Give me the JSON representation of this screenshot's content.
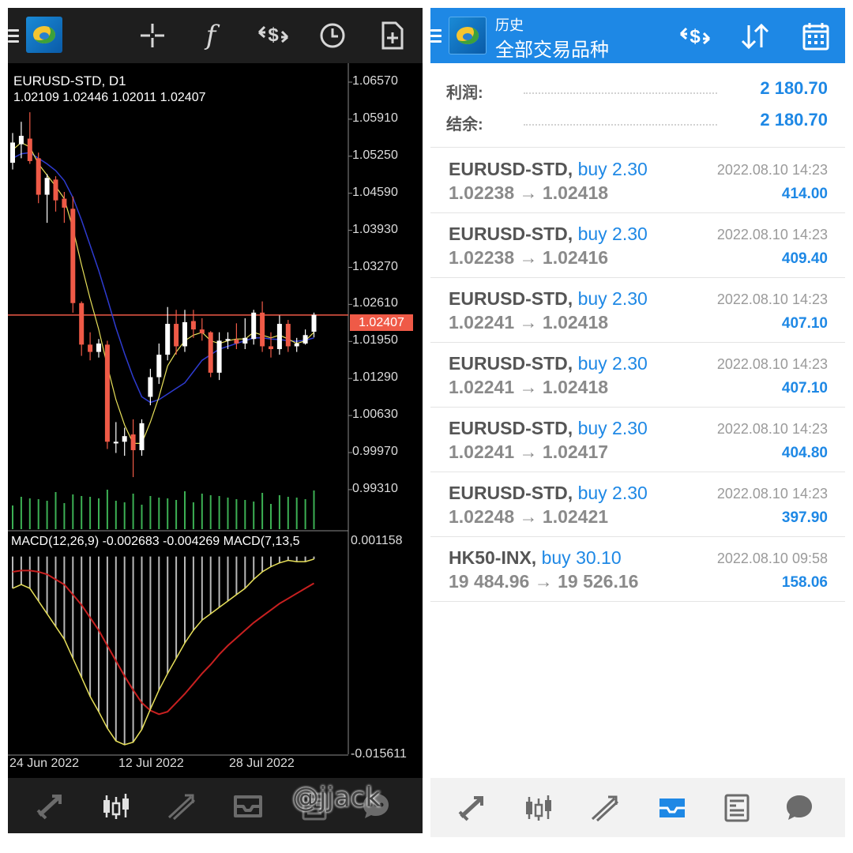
{
  "left": {
    "symbol": "EURUSD-STD, D1",
    "ohlc": "1.02109 1.02446 1.02011 1.02407",
    "price_scale": [
      "1.06570",
      "1.05910",
      "1.05250",
      "1.04590",
      "1.03930",
      "1.03270",
      "1.02610",
      "1.01950",
      "1.01290",
      "1.00630",
      "0.99970",
      "0.99310"
    ],
    "current_price": "1.02407",
    "macd_label": "MACD(12,26,9) -0.002683 -0.004269 MACD(7,13,5",
    "macd_scale_top": "0.001158",
    "macd_scale_bottom": "-0.015611",
    "dates": [
      "24 Jun 2022",
      "12 Jul 2022",
      "28 Jul 2022"
    ],
    "toolbar_icons": [
      "menu-icon",
      "app-logo",
      "crosshair-icon",
      "indicators-icon",
      "dollar-swap-icon",
      "timeframe-clock-icon",
      "new-order-icon"
    ],
    "nav_icons": [
      "quotes-icon",
      "chart-icon",
      "trade-icon",
      "history-icon",
      "news-icon",
      "chat-icon"
    ],
    "colors": {
      "bull": "#ffffff",
      "bear": "#ef5a47",
      "ma_fast": "#e8e05a",
      "ma_slow": "#2e3bd0",
      "macd_main": "#e8e05a",
      "macd_signal": "#c82020",
      "hist": "#b8b8b8",
      "volume": "#3cb054"
    }
  },
  "chart_data": {
    "type": "candlestick",
    "symbol": "EURUSD-STD",
    "timeframe": "D1",
    "candles": [
      {
        "o": 1.0512,
        "h": 1.0565,
        "l": 1.05,
        "c": 1.0548
      },
      {
        "o": 1.0545,
        "h": 1.0585,
        "l": 1.052,
        "c": 1.056
      },
      {
        "o": 1.0555,
        "h": 1.0602,
        "l": 1.051,
        "c": 1.0515
      },
      {
        "o": 1.052,
        "h": 1.053,
        "l": 1.044,
        "c": 1.0455
      },
      {
        "o": 1.0455,
        "h": 1.0492,
        "l": 1.0405,
        "c": 1.0485
      },
      {
        "o": 1.0482,
        "h": 1.0488,
        "l": 1.0425,
        "c": 1.0445
      },
      {
        "o": 1.0448,
        "h": 1.046,
        "l": 1.0405,
        "c": 1.0432
      },
      {
        "o": 1.043,
        "h": 1.0452,
        "l": 1.0245,
        "c": 1.0262
      },
      {
        "o": 1.0262,
        "h": 1.0265,
        "l": 1.0168,
        "c": 1.0188
      },
      {
        "o": 1.0188,
        "h": 1.021,
        "l": 1.016,
        "c": 1.0175
      },
      {
        "o": 1.0175,
        "h": 1.0198,
        "l": 1.0165,
        "c": 1.019
      },
      {
        "o": 1.0188,
        "h": 1.0195,
        "l": 1.0002,
        "c": 1.0015
      },
      {
        "o": 1.0012,
        "h": 1.005,
        "l": 0.9995,
        "c": 1.0015
      },
      {
        "o": 1.0015,
        "h": 1.004,
        "l": 0.999,
        "c": 1.0025
      },
      {
        "o": 1.0028,
        "h": 1.0055,
        "l": 0.9952,
        "c": 1.0
      },
      {
        "o": 1.0,
        "h": 1.0055,
        "l": 0.999,
        "c": 1.0048
      },
      {
        "o": 1.0095,
        "h": 1.0145,
        "l": 1.008,
        "c": 1.013
      },
      {
        "o": 1.013,
        "h": 1.019,
        "l": 1.0118,
        "c": 1.017
      },
      {
        "o": 1.017,
        "h": 1.0255,
        "l": 1.016,
        "c": 1.0225
      },
      {
        "o": 1.0225,
        "h": 1.025,
        "l": 1.017,
        "c": 1.0185
      },
      {
        "o": 1.0185,
        "h": 1.025,
        "l": 1.0175,
        "c": 1.0228
      },
      {
        "o": 1.023,
        "h": 1.025,
        "l": 1.02,
        "c": 1.0215
      },
      {
        "o": 1.0215,
        "h": 1.0235,
        "l": 1.0195,
        "c": 1.0208
      },
      {
        "o": 1.021,
        "h": 1.0212,
        "l": 1.013,
        "c": 1.0138
      },
      {
        "o": 1.0138,
        "h": 1.021,
        "l": 1.0125,
        "c": 1.0195
      },
      {
        "o": 1.0195,
        "h": 1.021,
        "l": 1.018,
        "c": 1.0198
      },
      {
        "o": 1.0197,
        "h": 1.0226,
        "l": 1.018,
        "c": 1.019
      },
      {
        "o": 1.019,
        "h": 1.0235,
        "l": 1.018,
        "c": 1.02
      },
      {
        "o": 1.0198,
        "h": 1.025,
        "l": 1.0188,
        "c": 1.0245
      },
      {
        "o": 1.0245,
        "h": 1.0265,
        "l": 1.0175,
        "c": 1.0185
      },
      {
        "o": 1.0185,
        "h": 1.021,
        "l": 1.0165,
        "c": 1.018
      },
      {
        "o": 1.018,
        "h": 1.024,
        "l": 1.017,
        "c": 1.0225
      },
      {
        "o": 1.0225,
        "h": 1.0232,
        "l": 1.0175,
        "c": 1.0185
      },
      {
        "o": 1.0185,
        "h": 1.02,
        "l": 1.0175,
        "c": 1.019
      },
      {
        "o": 1.019,
        "h": 1.0215,
        "l": 1.0188,
        "c": 1.0205
      },
      {
        "o": 1.0211,
        "h": 1.0245,
        "l": 1.0201,
        "c": 1.0241
      }
    ],
    "ma_fast": [
      1.0535,
      1.0548,
      1.054,
      1.051,
      1.049,
      1.047,
      1.0448,
      1.0395,
      1.033,
      1.027,
      1.0215,
      1.015,
      1.009,
      1.0045,
      1.0012,
      1.0012,
      1.005,
      1.0095,
      1.015,
      1.0175,
      1.0195,
      1.0205,
      1.021,
      1.0195,
      1.019,
      1.0195,
      1.0198,
      1.0198,
      1.021,
      1.0205,
      1.02,
      1.0205,
      1.0198,
      1.019,
      1.0195,
      1.021
    ],
    "ma_slow": [
      1.052,
      1.0528,
      1.053,
      1.052,
      1.051,
      1.0498,
      1.048,
      1.045,
      1.041,
      1.0365,
      1.032,
      1.027,
      1.0218,
      1.0172,
      1.013,
      1.0095,
      1.0085,
      1.009,
      1.01,
      1.011,
      1.012,
      1.014,
      1.016,
      1.017,
      1.018,
      1.0185,
      1.019,
      1.0195,
      1.02,
      1.02,
      1.0198,
      1.0197,
      1.0195,
      1.0194,
      1.0196,
      1.02
    ],
    "price_range": [
      0.9931,
      1.0657
    ],
    "macd_range": [
      -0.015611,
      0.001158
    ],
    "macd_main": [
      -0.0025,
      -0.0022,
      -0.0025,
      -0.0035,
      -0.0045,
      -0.0055,
      -0.0065,
      -0.008,
      -0.0095,
      -0.011,
      -0.0122,
      -0.0135,
      -0.0145,
      -0.0148,
      -0.0146,
      -0.0136,
      -0.012,
      -0.0105,
      -0.0092,
      -0.008,
      -0.0068,
      -0.0058,
      -0.005,
      -0.0045,
      -0.004,
      -0.0035,
      -0.003,
      -0.0025,
      -0.0018,
      -0.0012,
      -0.0008,
      -0.0005,
      -0.0003,
      -0.0004,
      -0.0004,
      -0.0002
    ],
    "macd_signal": [
      -0.0012,
      -0.0011,
      -0.0011,
      -0.0012,
      -0.0014,
      -0.0018,
      -0.0022,
      -0.003,
      -0.0038,
      -0.0048,
      -0.0058,
      -0.007,
      -0.0082,
      -0.0094,
      -0.0105,
      -0.0115,
      -0.0121,
      -0.0124,
      -0.0122,
      -0.0115,
      -0.0108,
      -0.01,
      -0.0092,
      -0.0085,
      -0.0077,
      -0.007,
      -0.0064,
      -0.0058,
      -0.0052,
      -0.0047,
      -0.0042,
      -0.0037,
      -0.0033,
      -0.0029,
      -0.0025,
      -0.0021
    ]
  },
  "right": {
    "title_line1": "历史",
    "title_line2": "全部交易品种",
    "toolbar_icons": [
      "dollar-swap-icon",
      "sort-icon",
      "calendar-icon"
    ],
    "summary": [
      {
        "label": "利润:",
        "value": "2 180.70"
      },
      {
        "label": "结余:",
        "value": "2 180.70"
      }
    ],
    "trades": [
      {
        "symbol": "EURUSD-STD,",
        "side": "buy 2.30",
        "prices": "1.02238 → 1.02418",
        "time": "2022.08.10 14:23",
        "profit": "414.00"
      },
      {
        "symbol": "EURUSD-STD,",
        "side": "buy 2.30",
        "prices": "1.02238 → 1.02416",
        "time": "2022.08.10 14:23",
        "profit": "409.40"
      },
      {
        "symbol": "EURUSD-STD,",
        "side": "buy 2.30",
        "prices": "1.02241 → 1.02418",
        "time": "2022.08.10 14:23",
        "profit": "407.10"
      },
      {
        "symbol": "EURUSD-STD,",
        "side": "buy 2.30",
        "prices": "1.02241 → 1.02418",
        "time": "2022.08.10 14:23",
        "profit": "407.10"
      },
      {
        "symbol": "EURUSD-STD,",
        "side": "buy 2.30",
        "prices": "1.02241 → 1.02417",
        "time": "2022.08.10 14:23",
        "profit": "404.80"
      },
      {
        "symbol": "EURUSD-STD,",
        "side": "buy 2.30",
        "prices": "1.02248 → 1.02421",
        "time": "2022.08.10 14:23",
        "profit": "397.90"
      },
      {
        "symbol": "HK50-INX,",
        "side": "buy 30.10",
        "prices": "19 484.96 → 19 526.16",
        "time": "2022.08.10 09:58",
        "profit": "158.06"
      }
    ],
    "nav_icons": [
      "quotes-icon",
      "chart-icon",
      "trade-icon",
      "history-icon",
      "news-icon",
      "chat-icon"
    ],
    "watermark": "@jjack",
    "colors": {
      "header": "#1e88e5",
      "accent": "#1e88e5"
    }
  }
}
